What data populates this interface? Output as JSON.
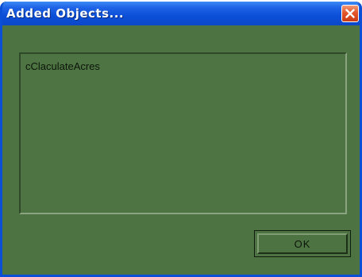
{
  "window": {
    "title": "Added Objects..."
  },
  "list": {
    "items": [
      "cClaculateAcres"
    ]
  },
  "buttons": {
    "ok_label": "OK"
  },
  "icons": {
    "close": "close-icon"
  },
  "colors": {
    "titlebar": "#0b4fd8",
    "dialog_background": "#4d7342",
    "close_button": "#e3552a"
  }
}
